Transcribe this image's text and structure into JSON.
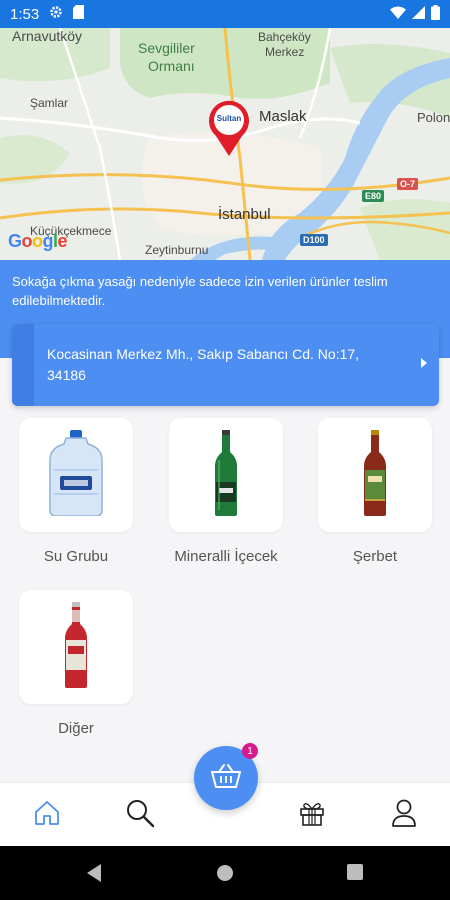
{
  "status_bar": {
    "time": "1:53"
  },
  "map": {
    "labels": {
      "arnavutkoy": "Arnavutköy",
      "sevgililer": "Sevgililer",
      "ormani": "Ormanı",
      "bahcekoy": "Bahçeköy",
      "merkez": "Merkez",
      "samlar": "Şamlar",
      "maslak": "Maslak",
      "polonez": "Polon",
      "istanbul": "İstanbul",
      "kucukcekmece": "Küçükçekmece",
      "zeytinburnu": "Zeytinburnu"
    },
    "road_badges": {
      "o7": "O-7",
      "e80": "E80",
      "d100": "D100"
    },
    "marker_text": "Sultan",
    "google": "Google"
  },
  "banner": {
    "text": "Sokağa çıkma yasağı nedeniyle sadece izin verilen ürünler teslim edilebilmektedir."
  },
  "address": {
    "text": "Kocasinan Merkez Mh., Sakıp Sabancı Cd. No:17, 34186"
  },
  "categories": [
    {
      "label": "Su Grubu",
      "icon": "water-jug-icon"
    },
    {
      "label": "Mineralli İçecek",
      "icon": "green-bottle-icon"
    },
    {
      "label": "Şerbet",
      "icon": "serbet-bottle-icon"
    },
    {
      "label": "Diğer",
      "icon": "red-bottle-icon"
    }
  ],
  "cart": {
    "badge": "1"
  },
  "bottom_nav": [
    "home-icon",
    "search-icon",
    "gift-icon",
    "profile-icon"
  ],
  "colors": {
    "primary": "#4d8ef2",
    "status_bar": "#1976e0",
    "badge": "#d81b8c",
    "marker": "#e11d2a"
  }
}
